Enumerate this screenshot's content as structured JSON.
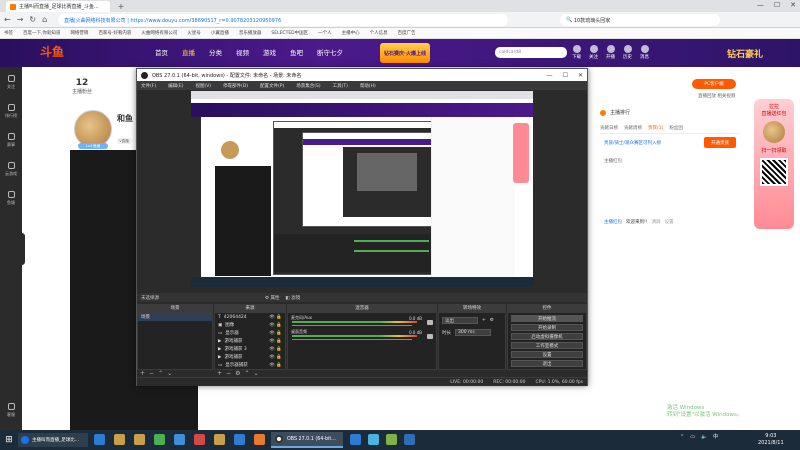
{
  "browser": {
    "tab_title": "主播叫而直播_足球比赛直播_斗鱼...",
    "url": "直播|火曲网络科技有限公司 | https://www.douyu.com/38690517_r=0.9078203120950976",
    "search_text": "10款琉璃头回家",
    "bookmarks": [
      "书签",
      "百度一下,你就知道",
      "网络营销",
      "百家号·好看内容",
      "火曲网络有限公司",
      "火星号",
      "小翼直播",
      "音乐播放器",
      "SELECTED中国区",
      "一个人",
      "主播中心",
      "个人信息",
      "百度广告"
    ]
  },
  "site": {
    "logo": "斗鱼",
    "nav": [
      "首页",
      "直播",
      "分类",
      "视频",
      "游戏",
      "鱼吧",
      "断守七夕"
    ],
    "nav_active": 1,
    "banner_promo": "钻石赛庆·火爆上线",
    "search_placeholder": "coldcard8",
    "icons": [
      "下载",
      "关注",
      "开播",
      "历史",
      "消息"
    ],
    "banner_right": "钻石豪礼"
  },
  "sidebar": [
    "关注",
    "排行榜",
    "赛事",
    "云游戏",
    "鱼塘",
    "客服"
  ],
  "streamer": {
    "fans": "12",
    "fans_label": "主播粉丝",
    "name": "和鱼",
    "level_badge": "Lv4·鱼塘",
    "v_badge": "V直播"
  },
  "right_panel": {
    "pc_button": "PC客户端",
    "live_list": "直播回放  相关视频",
    "header": "主播排行",
    "tabs": [
      "贡献日榜",
      "贡献周榜",
      "贵宾(1)",
      "粉丝团"
    ],
    "tab_selected": 2,
    "line1": "贵族/骑士/观众赛区可列入榜",
    "gift_button": "开通贵族",
    "line2": "主播红包",
    "chat_name": "主播红包",
    "chat_text": "欢迎来到!!",
    "chat_extra": "清屏",
    "chat_extra2": "设置"
  },
  "red_packet": {
    "title": "拉拉",
    "sub": "直播送红包",
    "label": "扫一扫领取"
  },
  "activate": [
    "激活 Windows",
    "转到\"设置\"以激活 Windows。"
  ],
  "obs": {
    "title": "OBS 27.0.1 (64-bit, windows) - 配置文件: 未命名 - 场景: 未命名",
    "menu": [
      "文件(F)",
      "编辑(E)",
      "视图(V)",
      "停靠部件(D)",
      "配置文件(P)",
      "场景集合(S)",
      "工具(T)",
      "帮助(H)"
    ],
    "scenebar": [
      "未选择源",
      "属性",
      "滤镜"
    ],
    "panels": {
      "scenes": "场景",
      "sources": "来源",
      "mixer": "混音器",
      "transitions": "转场特效",
      "controls": "控件"
    },
    "scenes": [
      "场景"
    ],
    "sources": [
      "42064424",
      "图像",
      "显示器",
      "游戏捕获",
      "游戏捕获 3",
      "游戏捕获",
      "显示器捕获"
    ],
    "mixer": [
      {
        "name": "麦克风/Aux",
        "value": "0.0 dB"
      },
      {
        "name": "桌面音频",
        "value": "0.0 dB"
      }
    ],
    "transition": {
      "type": "淡出",
      "duration_label": "时长",
      "duration": "300 ms"
    },
    "controls": [
      "开始推流",
      "开始录制",
      "启动虚拟摄像机",
      "工作室模式",
      "设置",
      "退出"
    ],
    "status": {
      "live": "LIVE: 00:00:00",
      "rec": "REC: 00:00:00",
      "cpu": "CPU: 1.0%, 60.00 fps"
    }
  },
  "taskbar": {
    "search": "主播叫而直播_足球比...",
    "obs_label": "OBS 27.0.1 (64-bit...",
    "tray_lang": "中",
    "time": "9:03",
    "date": "2021/8/11"
  }
}
